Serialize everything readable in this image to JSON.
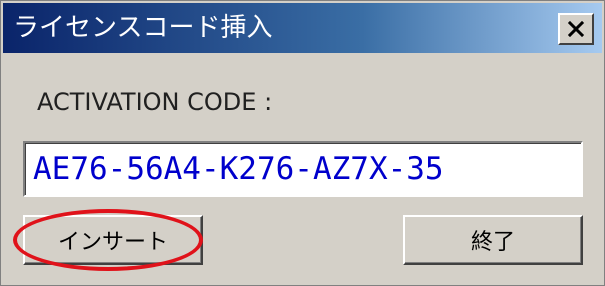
{
  "window": {
    "title": "ライセンスコード挿入",
    "close_icon": "close-x-icon"
  },
  "form": {
    "code_label": "ACTIVATION CODE :",
    "code_value": "AE76-56A4-K276-AZ7X-35"
  },
  "buttons": {
    "insert_label": "インサート",
    "exit_label": "終了"
  },
  "annotation": {
    "highlight_color": "#e0121a"
  },
  "colors": {
    "title_bar_start": "#0a246a",
    "title_bar_end": "#a6caf0",
    "dialog_face": "#d4d0c8",
    "code_text": "#0000cc"
  }
}
